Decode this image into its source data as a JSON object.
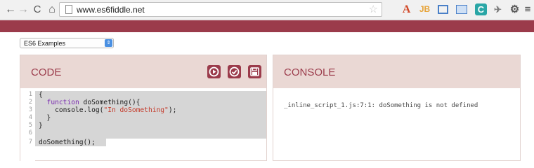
{
  "browser": {
    "url": "www.es6fiddle.net",
    "nav": {
      "back": "←",
      "forward": "→",
      "reload": "C",
      "home": "⌂"
    },
    "extensions": [
      "acrobat-a-icon",
      "jb-icon",
      "frame-icon",
      "image-icon",
      "c-icon",
      "satellite-icon",
      "gear-icon",
      "menu-icon"
    ],
    "ext_labels": {
      "a": "A",
      "jb": "JB",
      "c": "C"
    }
  },
  "brand": {
    "color": "#9b3b4b"
  },
  "examples_select": {
    "selected": "ES6 Examples"
  },
  "code_panel": {
    "title": "CODE",
    "lines": [
      {
        "num": "1",
        "text": "{"
      },
      {
        "num": "2",
        "kw": "function",
        "text": " doSomething(){"
      },
      {
        "num": "3",
        "pre": "    console.log(",
        "str": "\"In doSomething\"",
        "post": ");"
      },
      {
        "num": "4",
        "text": "  }"
      },
      {
        "num": "5",
        "text": "}"
      },
      {
        "num": "6",
        "text": ""
      },
      {
        "num": "7",
        "text": "doSomething();"
      }
    ]
  },
  "console_panel": {
    "title": "CONSOLE",
    "output": "_inline_script_1.js:7:1: doSomething is not defined"
  }
}
